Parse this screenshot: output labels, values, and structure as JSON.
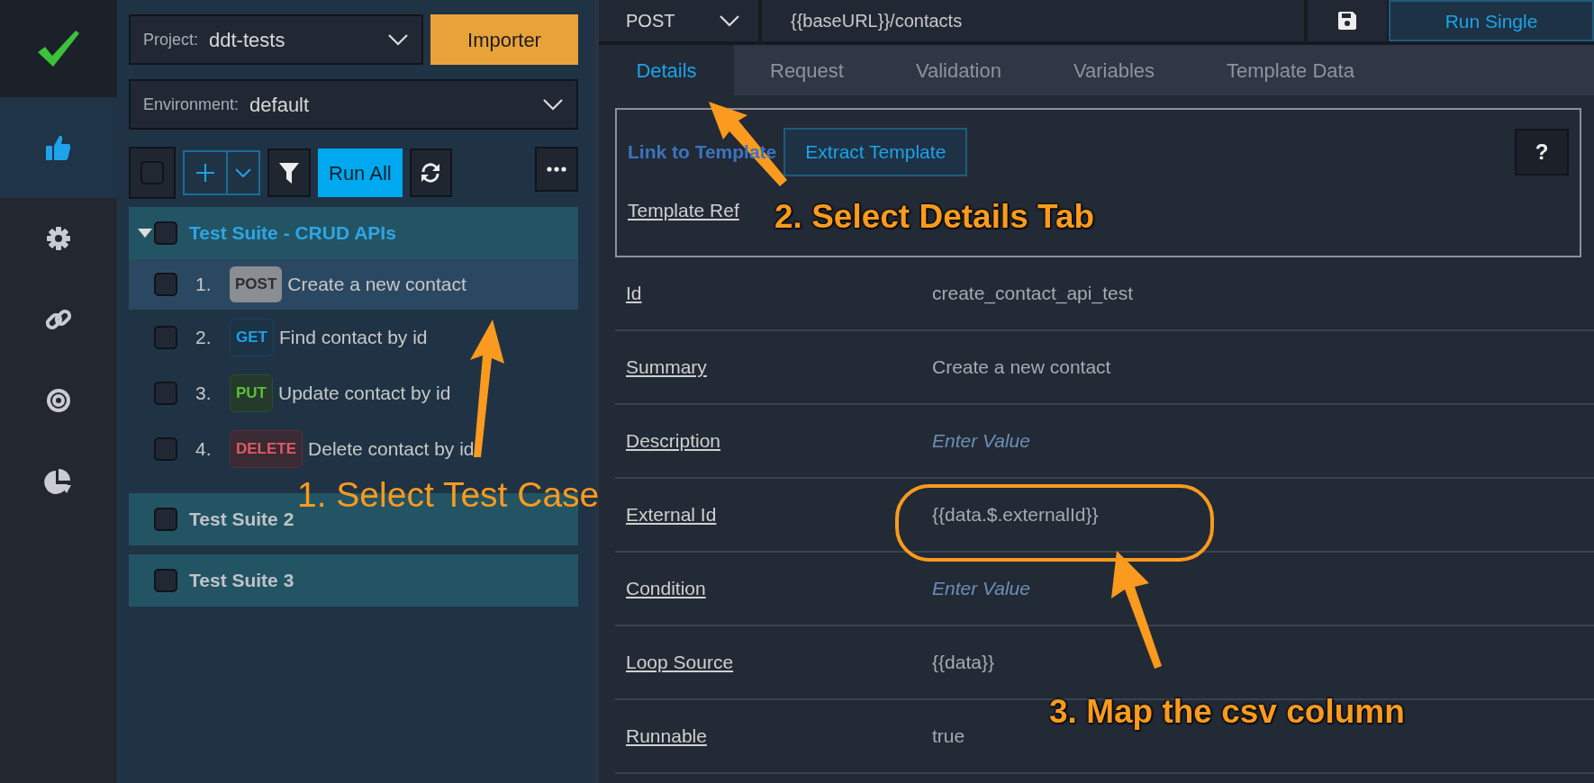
{
  "sidebar": {
    "items": [
      {
        "kind": "logo",
        "selected": false
      },
      {
        "kind": "thumbs",
        "selected": true
      },
      {
        "kind": "gear",
        "selected": false
      },
      {
        "kind": "link",
        "selected": false
      },
      {
        "kind": "target",
        "selected": false
      },
      {
        "kind": "pie",
        "selected": false
      }
    ]
  },
  "project": {
    "label": "Project:",
    "value": "ddt-tests"
  },
  "import_button": "Importer",
  "environment": {
    "label": "Environment:",
    "value": "default"
  },
  "toolbar": {
    "select_all_checked": false,
    "run_all": "Run All"
  },
  "suites": [
    {
      "title": "Test Suite - CRUD APIs",
      "checked": false,
      "expanded": true,
      "children": [
        {
          "number": "1.",
          "method": "POST",
          "kind": "post",
          "title": "Create a new contact",
          "checked": false,
          "selected": true
        },
        {
          "number": "2.",
          "method": "GET",
          "kind": "get",
          "title": "Find contact by id",
          "checked": false,
          "selected": false
        },
        {
          "number": "3.",
          "method": "PUT",
          "kind": "put",
          "title": "Update contact by id",
          "checked": false,
          "selected": false
        },
        {
          "number": "4.",
          "method": "DELETE",
          "kind": "delete",
          "title": "Delete contact by id",
          "checked": false,
          "selected": false
        }
      ]
    },
    {
      "title": "Test Suite 2",
      "checked": false,
      "expanded": false
    },
    {
      "title": "Test Suite 3",
      "checked": false,
      "expanded": false
    }
  ],
  "request": {
    "method": "POST",
    "url": "{{baseURL}}/contacts",
    "run_button": "Run Single"
  },
  "tabs": [
    {
      "label": "Details",
      "selected": true
    },
    {
      "label": "Request",
      "selected": false
    },
    {
      "label": "Validation",
      "selected": false
    },
    {
      "label": "Variables",
      "selected": false
    },
    {
      "label": "Template Data",
      "selected": false
    }
  ],
  "template": {
    "link": "Link to Template",
    "extract_button": "Extract Template",
    "help_button": "?",
    "ref_label": "Template Ref"
  },
  "fields": [
    {
      "label": "Id",
      "value": "create_contact_api_test"
    },
    {
      "label": "Summary",
      "value": "Create a new contact"
    },
    {
      "label": "Description",
      "placeholder": "Enter Value"
    },
    {
      "label": "External Id",
      "value": "{{data.$.externalId}}"
    },
    {
      "label": "Condition",
      "placeholder": "Enter Value"
    },
    {
      "label": "Loop Source",
      "value": "{{data}}"
    },
    {
      "label": "Runnable",
      "value": "true"
    }
  ],
  "annotations": [
    {
      "text": "1. Select Test Case",
      "kind": "plain"
    },
    {
      "text": "2. Select Details Tab",
      "kind": "outlined"
    },
    {
      "text": "3. Map the csv column",
      "kind": "outlined"
    }
  ]
}
